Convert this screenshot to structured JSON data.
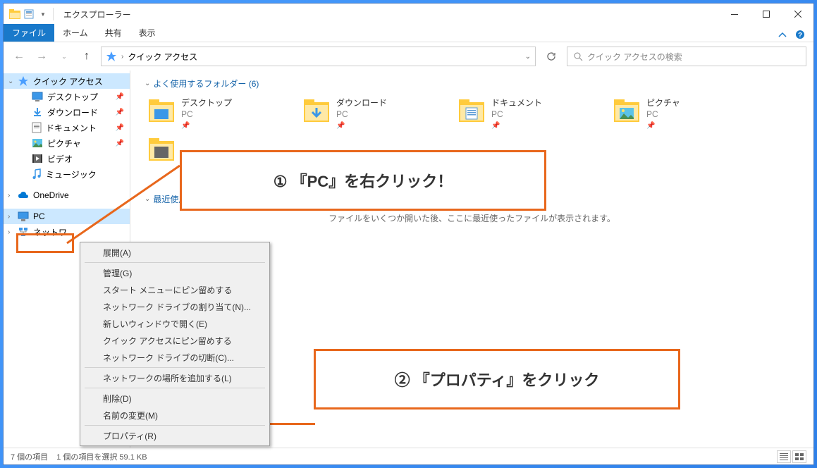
{
  "window": {
    "title": "エクスプローラー"
  },
  "ribbon": {
    "file": "ファイル",
    "home": "ホーム",
    "share": "共有",
    "view": "表示"
  },
  "address": {
    "location": "クイック アクセス"
  },
  "search": {
    "placeholder": "クイック アクセスの検索"
  },
  "sidebar": {
    "quickaccess": "クイック アクセス",
    "desktop": "デスクトップ",
    "downloads": "ダウンロード",
    "documents": "ドキュメント",
    "pictures": "ピクチャ",
    "videos": "ビデオ",
    "music": "ミュージック",
    "onedrive": "OneDrive",
    "pc": "PC",
    "network": "ネットワ"
  },
  "sections": {
    "frequent": "よく使用するフォルダー (6)",
    "recent": "最近使用",
    "empty_msg": "ファイルをいくつか開いた後、ここに最近使ったファイルが表示されます。"
  },
  "folders": {
    "desktop": {
      "name": "デスクトップ",
      "loc": "PC"
    },
    "downloads": {
      "name": "ダウンロード",
      "loc": "PC"
    },
    "documents": {
      "name": "ドキュメント",
      "loc": "PC"
    },
    "pictures": {
      "name": "ピクチャ",
      "loc": "PC"
    }
  },
  "context_menu": {
    "expand": "展開(A)",
    "manage": "管理(G)",
    "pin_start": "スタート メニューにピン留めする",
    "map_drive": "ネットワーク ドライブの割り当て(N)...",
    "new_window": "新しいウィンドウで開く(E)",
    "pin_qa": "クイック アクセスにピン留めする",
    "disconnect": "ネットワーク ドライブの切断(C)...",
    "add_location": "ネットワークの場所を追加する(L)",
    "delete": "削除(D)",
    "rename": "名前の変更(M)",
    "properties": "プロパティ(R)"
  },
  "status": {
    "items": "7 個の項目",
    "selected": "1 個の項目を選択 59.1 KB"
  },
  "callouts": {
    "one": "① 『PC』を右クリック！",
    "two": "② 『プロパティ』をクリック"
  }
}
